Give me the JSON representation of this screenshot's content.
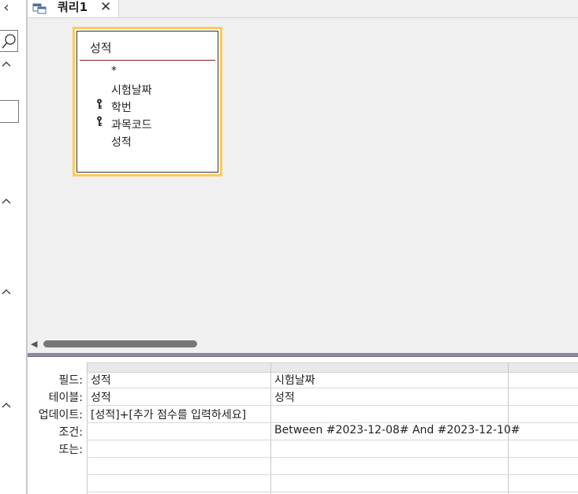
{
  "tab": {
    "title": "쿼리1",
    "close": "✕"
  },
  "table": {
    "name": "성적",
    "fields": [
      {
        "name": "*",
        "key": false
      },
      {
        "name": "시험날짜",
        "key": false
      },
      {
        "name": "학번",
        "key": true
      },
      {
        "name": "과목코드",
        "key": true
      },
      {
        "name": "성적",
        "key": false
      }
    ]
  },
  "grid": {
    "row_labels": [
      "필드:",
      "테이블:",
      "업데이트:",
      "조건:",
      "또는:"
    ],
    "columns": [
      {
        "field": "성적",
        "table": "성적",
        "update": "[성적]+[추가 점수를 입력하세요]",
        "criteria": "",
        "or": ""
      },
      {
        "field": "시험날짜",
        "table": "성적",
        "update": "",
        "criteria": "Between #2023-12-08# And #2023-12-10#",
        "or": ""
      },
      {
        "field": "",
        "table": "",
        "update": "",
        "criteria": "",
        "or": ""
      }
    ]
  },
  "icons": {
    "nav_collapse": "chevron-left-icon",
    "search": "search-icon",
    "section_toggle": "chevron-up-icon",
    "query": "query-icon",
    "primary_key": "key-icon"
  }
}
